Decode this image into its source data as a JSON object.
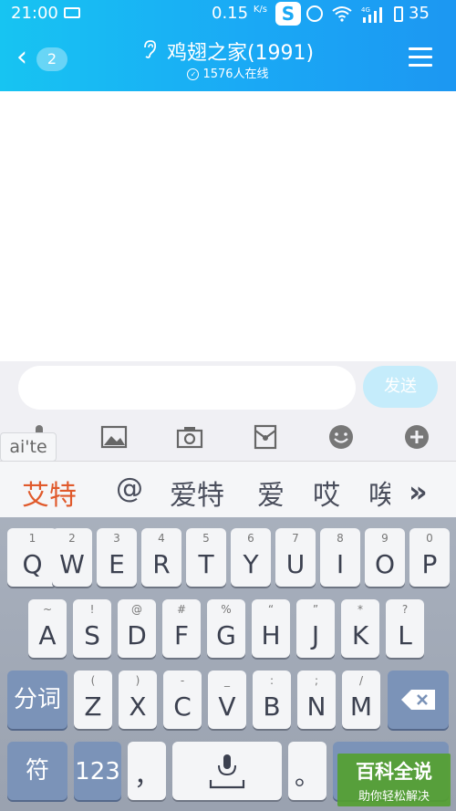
{
  "status_bar": {
    "time": "21:00",
    "speed": "0.15",
    "speed_unit": "K/s",
    "sogou_letter": "S",
    "network": "4G",
    "battery": "35"
  },
  "header": {
    "back_badge": "2",
    "title": "鸡翅之家(1991)",
    "online": "1576人在线"
  },
  "input": {
    "value": "",
    "placeholder": "",
    "send_label": "发送"
  },
  "tools": [
    "mic-icon",
    "image-icon",
    "camera-icon",
    "red-packet-icon",
    "emoji-icon",
    "plus-icon"
  ],
  "ime": {
    "pinyin": "ai'te",
    "candidates": [
      "艾特",
      "@",
      "爱特",
      "爱",
      "哎",
      "唉"
    ],
    "rows": [
      [
        {
          "main": "Q",
          "sub": "1"
        },
        {
          "main": "W",
          "sub": "2"
        },
        {
          "main": "E",
          "sub": "3"
        },
        {
          "main": "R",
          "sub": "4"
        },
        {
          "main": "T",
          "sub": "5"
        },
        {
          "main": "Y",
          "sub": "6"
        },
        {
          "main": "U",
          "sub": "7"
        },
        {
          "main": "I",
          "sub": "8"
        },
        {
          "main": "O",
          "sub": "9"
        },
        {
          "main": "P",
          "sub": "0"
        }
      ],
      [
        {
          "main": "A",
          "sub": "~"
        },
        {
          "main": "S",
          "sub": "!"
        },
        {
          "main": "D",
          "sub": "@"
        },
        {
          "main": "F",
          "sub": "#"
        },
        {
          "main": "G",
          "sub": "%"
        },
        {
          "main": "H",
          "sub": "“"
        },
        {
          "main": "J",
          "sub": "”"
        },
        {
          "main": "K",
          "sub": "*"
        },
        {
          "main": "L",
          "sub": "?"
        }
      ],
      [
        {
          "main": "Z",
          "sub": "("
        },
        {
          "main": "X",
          "sub": ")"
        },
        {
          "main": "C",
          "sub": "-"
        },
        {
          "main": "V",
          "sub": "_"
        },
        {
          "main": "B",
          "sub": ":"
        },
        {
          "main": "N",
          "sub": ";"
        },
        {
          "main": "M",
          "sub": "/"
        }
      ]
    ],
    "fenci_label": "分词",
    "fu_label": "符",
    "num_label": "123",
    "comma_label": "，",
    "period_label": "。"
  },
  "watermark": {
    "title": "百科全说",
    "subtitle": "助你轻松解决"
  }
}
